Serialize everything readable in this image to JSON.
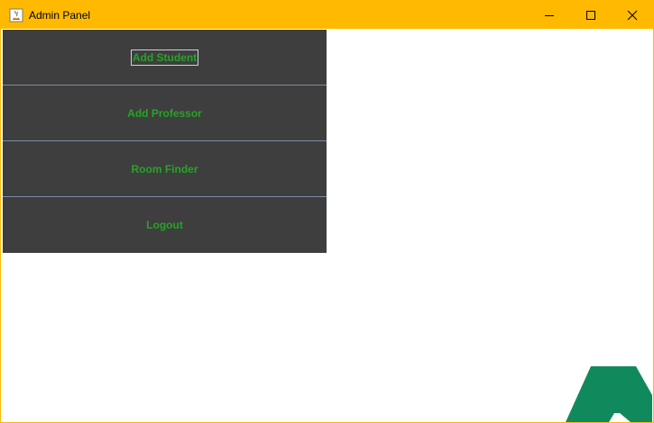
{
  "window": {
    "title": "Admin Panel",
    "titlebar_color": "#ffba00",
    "controls": {
      "minimize": "minimize-icon",
      "maximize": "maximize-icon",
      "close": "close-icon"
    }
  },
  "menu": {
    "background": "#3e3e3e",
    "text_color": "#27a327",
    "items": [
      {
        "label": "Add Student",
        "focused": true
      },
      {
        "label": "Add Professor",
        "focused": false
      },
      {
        "label": "Room Finder",
        "focused": false
      },
      {
        "label": "Logout",
        "focused": false
      }
    ]
  },
  "logo": {
    "color": "#108a5c"
  }
}
